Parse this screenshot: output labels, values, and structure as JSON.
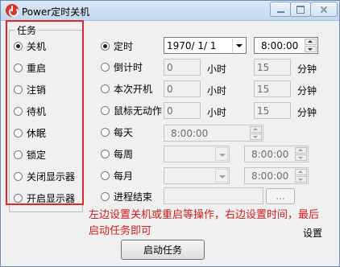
{
  "window": {
    "title": "Power定时关机"
  },
  "tasks": {
    "group_label": "任务",
    "items": [
      {
        "label": "关机",
        "checked": true
      },
      {
        "label": "重启",
        "checked": false
      },
      {
        "label": "注销",
        "checked": false
      },
      {
        "label": "待机",
        "checked": false
      },
      {
        "label": "休眠",
        "checked": false
      },
      {
        "label": "锁定",
        "checked": false
      },
      {
        "label": "关闭显示器",
        "checked": false
      },
      {
        "label": "开启显示器",
        "checked": false
      }
    ]
  },
  "timing": {
    "scheduled": {
      "label": "定时",
      "checked": true,
      "date": "1970/  1/  1",
      "time": "8:00:00"
    },
    "countdown": {
      "label": "倒计时",
      "hours": "0",
      "hours_unit": "小时",
      "minutes": "15",
      "minutes_unit": "分钟"
    },
    "after_boot": {
      "label": "本次开机",
      "hours": "0",
      "hours_unit": "小时",
      "minutes": "15",
      "minutes_unit": "分钟"
    },
    "mouse_idle": {
      "label": "鼠标无动作",
      "hours": "0",
      "hours_unit": "小时",
      "minutes": "15",
      "minutes_unit": "分钟"
    },
    "daily": {
      "label": "每天",
      "time": "8:00:00"
    },
    "weekly": {
      "label": "每周",
      "day": "",
      "time": "8:00:00"
    },
    "monthly": {
      "label": "每月",
      "day": "",
      "time": "8:00:00"
    },
    "process_end": {
      "label": "进程结束",
      "process": "",
      "browse_label": "..."
    }
  },
  "annotation": "左边设置关机或重启等操作，右边设置时间，最后启动任务即可",
  "settings_link": "设置",
  "start_button": "启动任务",
  "colors": {
    "highlight": "#e0262a",
    "note_text": "#d01d1d"
  }
}
